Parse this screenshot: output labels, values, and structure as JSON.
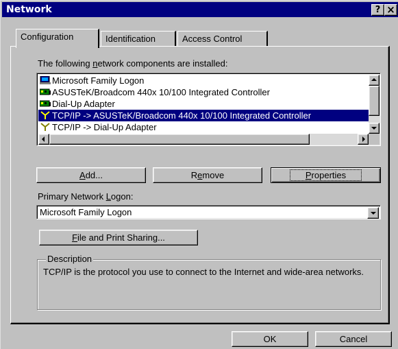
{
  "window": {
    "title": "Network",
    "help_glyph": "?",
    "close_glyph": "×"
  },
  "tabs": [
    {
      "label": "Configuration",
      "active": true
    },
    {
      "label": "Identification",
      "active": false
    },
    {
      "label": "Access Control",
      "active": false
    }
  ],
  "components": {
    "label_pre": "The following ",
    "label_key": "n",
    "label_post": "etwork components are installed:",
    "items": [
      {
        "label": "Microsoft Family Logon",
        "icon": "client-icon",
        "selected": false
      },
      {
        "label": "ASUSTeK/Broadcom 440x 10/100 Integrated Controller",
        "icon": "network-adapter-icon",
        "selected": false
      },
      {
        "label": "Dial-Up Adapter",
        "icon": "network-adapter-icon",
        "selected": false
      },
      {
        "label": "TCP/IP -> ASUSTeK/Broadcom 440x 10/100 Integrated Controller",
        "icon": "protocol-icon",
        "selected": true
      },
      {
        "label": "TCP/IP -> Dial-Up Adapter",
        "icon": "protocol-icon",
        "selected": false
      }
    ]
  },
  "buttons": {
    "add_key": "A",
    "add_rest": "dd...",
    "remove_pre": "R",
    "remove_key": "e",
    "remove_rest": "move",
    "properties_key": "P",
    "properties_rest": "roperties"
  },
  "logon": {
    "label_pre": "Primary Network ",
    "label_key": "L",
    "label_post": "ogon:",
    "value": "Microsoft Family Logon"
  },
  "sharing": {
    "key": "F",
    "rest": "ile and Print Sharing..."
  },
  "description": {
    "legend": "Description",
    "text": "TCP/IP is the protocol you use to connect to the Internet and wide-area networks."
  },
  "footer": {
    "ok": "OK",
    "cancel": "Cancel"
  },
  "colors": {
    "face": "#c0c0c0",
    "title": "#000080",
    "selection": "#000080"
  }
}
